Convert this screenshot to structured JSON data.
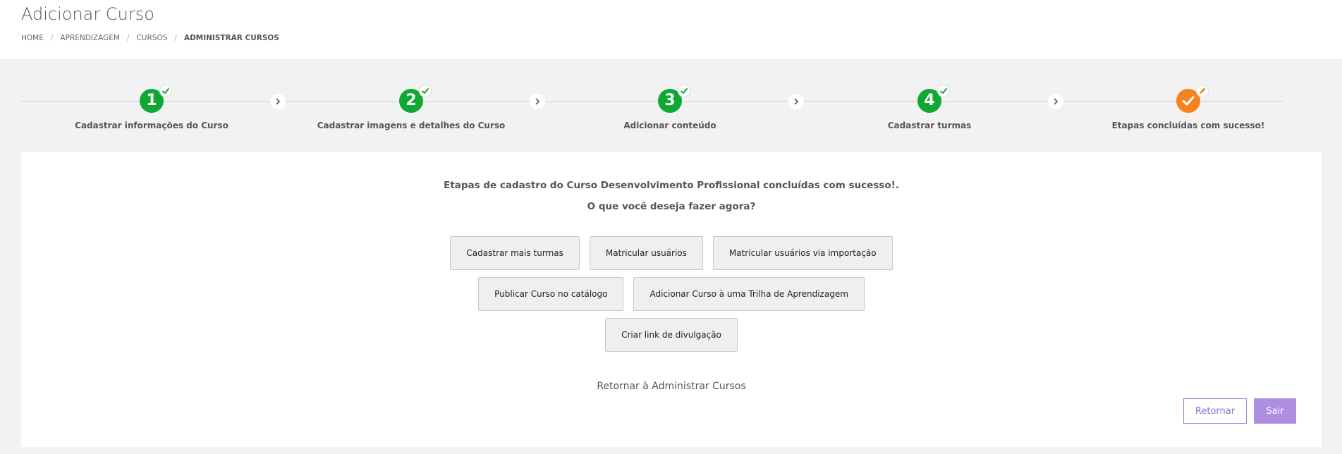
{
  "page": {
    "title": "Adicionar Curso"
  },
  "breadcrumb": {
    "items": [
      "HOME",
      "APRENDIZAGEM",
      "CURSOS",
      "ADMINISTRAR CURSOS"
    ],
    "separator": "/"
  },
  "stepper": {
    "steps": [
      {
        "number": "1",
        "label": "Cadastrar informações do Curso",
        "status": "done",
        "badge_icon": "check-icon"
      },
      {
        "number": "2",
        "label": "Cadastrar imagens e detalhes do Curso",
        "status": "done",
        "badge_icon": "check-icon"
      },
      {
        "number": "3",
        "label": "Adicionar conteúdo",
        "status": "done",
        "badge_icon": "check-icon"
      },
      {
        "number": "4",
        "label": "Cadastrar turmas",
        "status": "done",
        "badge_icon": "check-icon"
      },
      {
        "number": "",
        "label": "Etapas concluídas com sucesso!",
        "status": "current",
        "badge_icon": "pencil-icon"
      }
    ],
    "colors": {
      "done": "#0fa832",
      "current": "#f58220"
    }
  },
  "main": {
    "success_message": "Etapas de cadastro do Curso Desenvolvimento Profissional concluídas com sucesso!.",
    "question": "O que você deseja fazer agora?",
    "actions": {
      "row1": [
        "Cadastrar mais turmas",
        "Matricular usuários",
        "Matricular usuários via importação"
      ],
      "row2": [
        "Publicar Curso no catálogo",
        "Adicionar Curso à uma Trilha de Aprendizagem"
      ],
      "row3": [
        "Criar link de divulgação"
      ]
    },
    "return_link": "Retornar à Administrar Cursos"
  },
  "footer_buttons": {
    "back_label": "Retornar",
    "exit_label": "Sair",
    "accent": "#ad8ee0"
  }
}
